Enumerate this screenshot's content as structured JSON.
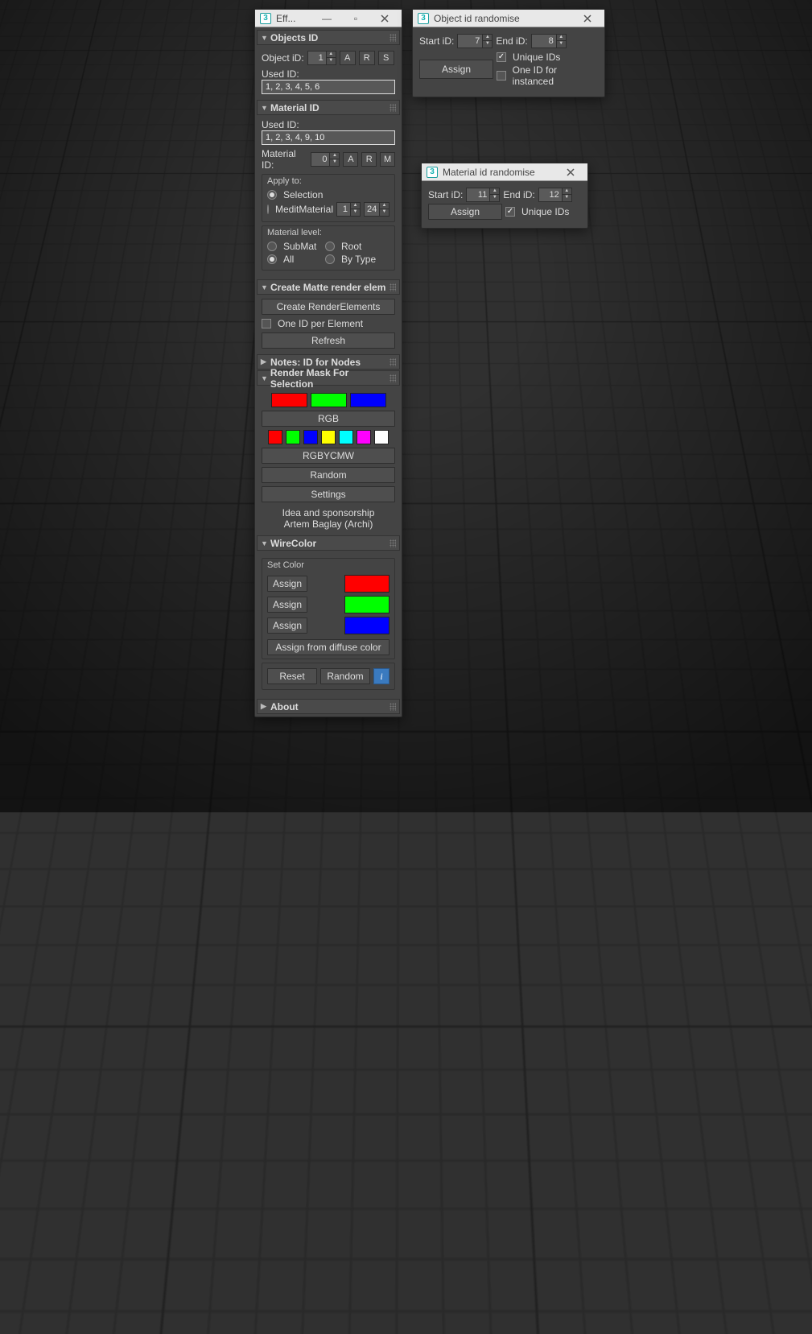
{
  "win1": {
    "title": "Eff...",
    "objects_id": {
      "header": "Objects ID",
      "object_id_label": "Object iD:",
      "object_id_value": "1",
      "btn_a": "A",
      "btn_r": "R",
      "btn_s": "S",
      "used_label": "Used ID:",
      "used_value": "1, 2, 3, 4, 5, 6"
    },
    "material_id": {
      "header": "Material ID",
      "used_label": "Used ID:",
      "used_value": "1, 2, 3, 4, 9, 10",
      "material_id_label": "Material ID:",
      "material_id_value": "0",
      "btn_a": "A",
      "btn_r": "R",
      "btn_m": "M",
      "apply_to": "Apply to:",
      "selection": "Selection",
      "medit": "MeditMaterial",
      "medit_from": "1",
      "medit_to": "24",
      "mat_level": "Material level:",
      "submat": "SubMat",
      "root": "Root",
      "all": "All",
      "bytype": "By Type"
    },
    "matte": {
      "header": "Create Matte render elem",
      "create_btn": "Create RenderElements",
      "one_id": "One ID per Element",
      "refresh": "Refresh"
    },
    "notes": {
      "header": "Notes: ID for Nodes"
    },
    "mask": {
      "header": "Render Mask For Selection",
      "rgb": "RGB",
      "rgbycmw": "RGBYCMW",
      "random": "Random",
      "settings": "Settings",
      "sponsor1": "Idea and sponsorship",
      "sponsor2": "Artem Baglay (Archi)"
    },
    "wire": {
      "header": "WireColor",
      "set_color": "Set Color",
      "assign": "Assign",
      "assign_diffuse": "Assign from diffuse color",
      "reset": "Reset",
      "random": "Random",
      "info": "i"
    },
    "about": {
      "header": "About"
    },
    "colors": {
      "rgb": [
        "#ff0000",
        "#00ff00",
        "#0000ff"
      ],
      "rgbycmw": [
        "#ff0000",
        "#00ff00",
        "#0000ff",
        "#ffff00",
        "#00ffff",
        "#ff00ff",
        "#ffffff"
      ],
      "wire": [
        "#ff0000",
        "#00ff00",
        "#0000ff"
      ]
    }
  },
  "win2": {
    "title": "Object id randomise",
    "start_label": "Start iD:",
    "start": "7",
    "end_label": "End iD:",
    "end": "8",
    "assign": "Assign",
    "unique": "Unique IDs",
    "one_instanced": "One ID for instanced"
  },
  "win3": {
    "title": "Material id randomise",
    "start_label": "Start iD:",
    "start": "11",
    "end_label": "End iD:",
    "end": "12",
    "assign": "Assign",
    "unique": "Unique IDs"
  }
}
